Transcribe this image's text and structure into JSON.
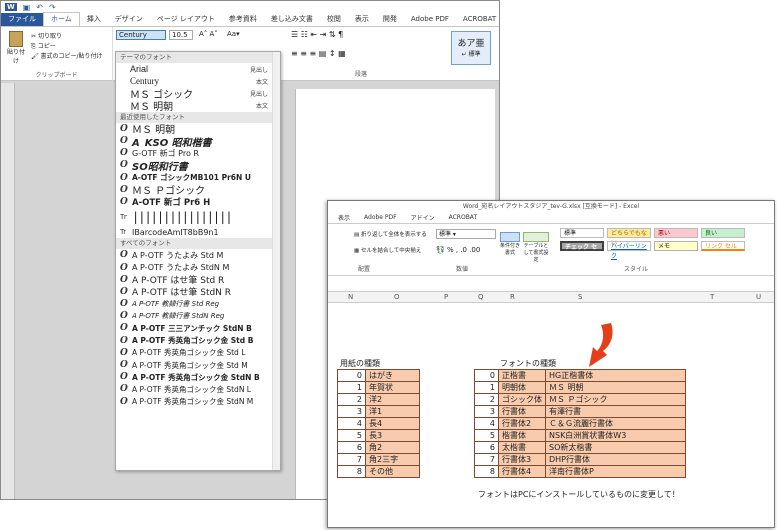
{
  "word": {
    "tabs": [
      "ファイル",
      "ホーム",
      "挿入",
      "デザイン",
      "ページ レイアウト",
      "参考資料",
      "差し込み文書",
      "校閲",
      "表示",
      "開発",
      "Adobe PDF",
      "ACROBAT"
    ],
    "active_tab": "ホーム",
    "font_name": "Century",
    "font_size": "10.5",
    "clipboard": {
      "paste": "貼り付け",
      "cut": "切り取り",
      "copy": "コピー",
      "format": "書式のコピー/貼り付け",
      "group": "クリップボード"
    },
    "paragraph_group": "段落",
    "style_sample": "あア亜",
    "style_name": "↵ 標準",
    "dropdown": {
      "theme_header": "テーマのフォント",
      "theme_fonts": [
        {
          "name": "Arial",
          "tag": "見出し"
        },
        {
          "name": "Century",
          "tag": "本文"
        },
        {
          "name": "ＭＳ ゴシック",
          "tag": "見出し"
        },
        {
          "name": "ＭＳ 明朝",
          "tag": "本文"
        }
      ],
      "recent_header": "最近使用したフォント",
      "recent_fonts": [
        "ＭＳ 明朝",
        "A_KSO 昭和楷書",
        "G-OTF 新ゴ Pro R",
        "SO昭和行書",
        "A-OTF ゴシックMB101 Pr6N U",
        "ＭＳ Ｐゴシック",
        "A-OTF 新ゴ Pr6 H",
        "||||||||||||||||",
        "IBarcodeAmIT8bB9n1"
      ],
      "all_header": "すべてのフォント",
      "all_fonts": [
        "A P-OTF うたよみ Std M",
        "A P-OTF うたよみ StdN M",
        "A P-OTF はせ筆 Std R",
        "A P-OTF はせ筆 StdN R",
        "A P-OTF 教隷行書 Std Reg",
        "A P-OTF 教隷行書 StdN Reg",
        "A P-OTF 三三アンチック StdN B",
        "A P-OTF 秀英角ゴシック金 Std B",
        "A P-OTF 秀英角ゴシック金 Std L",
        "A P-OTF 秀英角ゴシック金 Std M",
        "A P-OTF 秀英角ゴシック金 StdN B",
        "A P-OTF 秀英角ゴシック金 StdN L",
        "A P-OTF 秀英角ゴシック金 StdN M"
      ]
    }
  },
  "excel": {
    "title": "Word_宛名レイアウトスタジア_tev-G.xlsx [互換モード] - Excel",
    "tabs": [
      "表示",
      "Adobe PDF",
      "アドイン",
      "ACROBAT"
    ],
    "wrap": "折り返して全体を表示する",
    "merge": "セルを結合して中央揃え",
    "number_format": "標準",
    "groups": {
      "align": "配置",
      "number": "数値",
      "style": "スタイル"
    },
    "cond_format": "条件付き書式",
    "table_format": "テーブルとして書式設定",
    "styles": [
      "標準",
      "どちらでもない",
      "悪い",
      "良い",
      "チェック セル",
      "ハイパーリンク",
      "メモ",
      "リンク セル"
    ],
    "columns": [
      "N",
      "O",
      "P",
      "Q",
      "R",
      "S",
      "T",
      "U"
    ],
    "paper": {
      "title": "用紙の種類",
      "rows": [
        [
          "0",
          "はがき"
        ],
        [
          "1",
          "年賀状"
        ],
        [
          "2",
          "洋2"
        ],
        [
          "3",
          "洋1"
        ],
        [
          "4",
          "長4"
        ],
        [
          "5",
          "長3"
        ],
        [
          "6",
          "角2"
        ],
        [
          "7",
          "角2三字"
        ],
        [
          "8",
          "その他"
        ]
      ]
    },
    "font": {
      "title": "フォントの種類",
      "rows": [
        [
          "0",
          "正楷書",
          "HG正楷書体"
        ],
        [
          "1",
          "明朝体",
          "ＭＳ 明朝"
        ],
        [
          "2",
          "ゴシック体",
          "ＭＳ Ｐゴシック"
        ],
        [
          "3",
          "行書体",
          "有澤行書"
        ],
        [
          "4",
          "行書体2",
          "Ｃ＆Ｇ流麗行書体"
        ],
        [
          "5",
          "楷書体",
          "NSK白洲賞状書体W3"
        ],
        [
          "6",
          "太楷書",
          "SO新太楷書"
        ],
        [
          "7",
          "行書体3",
          "DHP行書体"
        ],
        [
          "8",
          "行書体4",
          "洋南行書体P"
        ]
      ]
    },
    "note": "フォントはPCにインストールしているものに変更して！"
  },
  "colors": {
    "word_blue": "#2b579a",
    "excel_green": "#217346",
    "peach": "#f9cbad",
    "arrow": "#e3401a"
  }
}
